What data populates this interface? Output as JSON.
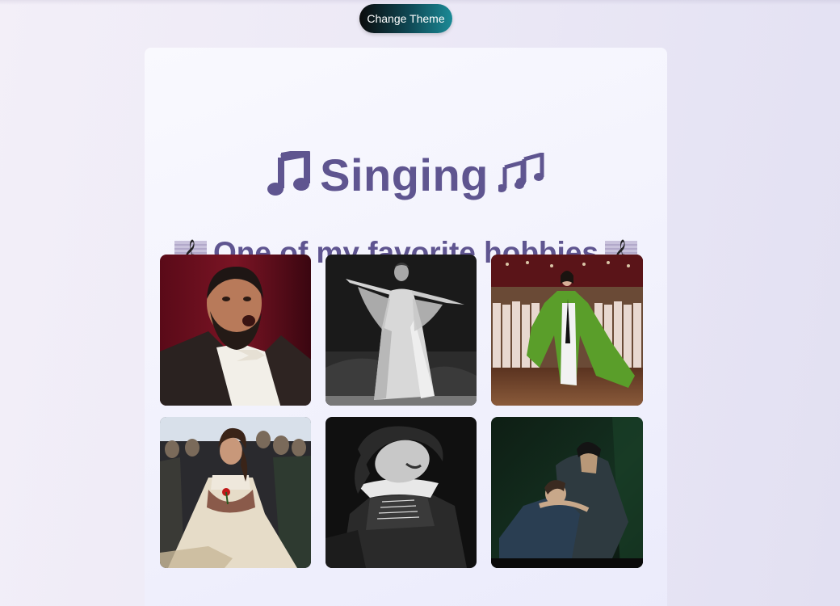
{
  "header": {
    "theme_button_label": "Change Theme"
  },
  "hero": {
    "title": "Singing",
    "title_icon_left": "music-note-icon",
    "title_icon_right": "music-notes-icon",
    "subtitle": "One of my favorite hobbies",
    "subtitle_icon": "musical-score-icon"
  },
  "colors": {
    "accent": "#5f5590",
    "button_start": "#0b0b0c",
    "button_end": "#1b8a96"
  },
  "gallery": {
    "photos": [
      {
        "subject": "tenor in tuxedo singing"
      },
      {
        "subject": "black and white soprano in white gown"
      },
      {
        "subject": "singer in green gown on stage with chorus"
      },
      {
        "subject": "soprano in cream dress with red rose"
      },
      {
        "subject": "black and white singer in corset"
      },
      {
        "subject": "two singers embracing in dark scene"
      }
    ]
  }
}
